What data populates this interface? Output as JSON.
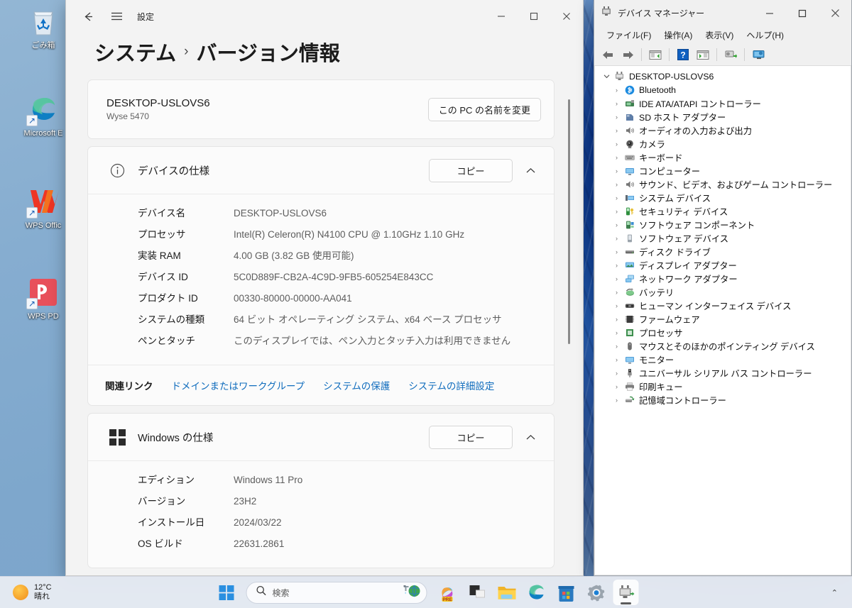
{
  "desktop": {
    "icons": [
      {
        "name": "recycle-bin",
        "label": "ごみ箱"
      },
      {
        "name": "microsoft-edge",
        "label": "Microsoft E"
      },
      {
        "name": "wps-office",
        "label": "WPS Offic"
      },
      {
        "name": "wps-pdf",
        "label": "WPS PD"
      }
    ]
  },
  "settings": {
    "title": "設定",
    "breadcrumb": {
      "parent": "システム",
      "separator": "›",
      "current": "バージョン情報"
    },
    "window_buttons": {
      "minimize": "—",
      "maximize": "☐",
      "close": "✕"
    },
    "pc_card": {
      "name": "DESKTOP-USLOVS6",
      "model": "Wyse 5470",
      "rename_button": "この PC の名前を変更"
    },
    "device_spec": {
      "title": "デバイスの仕様",
      "copy_button": "コピー",
      "rows": [
        {
          "key": "デバイス名",
          "value": "DESKTOP-USLOVS6"
        },
        {
          "key": "プロセッサ",
          "value": "Intel(R) Celeron(R) N4100 CPU @ 1.10GHz   1.10 GHz"
        },
        {
          "key": "実装 RAM",
          "value": "4.00 GB (3.82 GB 使用可能)"
        },
        {
          "key": "デバイス ID",
          "value": "5C0D889F-CB2A-4C9D-9FB5-605254E843CC"
        },
        {
          "key": "プロダクト ID",
          "value": "00330-80000-00000-AA041"
        },
        {
          "key": "システムの種類",
          "value": "64 ビット オペレーティング システム、x64 ベース プロセッサ"
        },
        {
          "key": "ペンとタッチ",
          "value": "このディスプレイでは、ペン入力とタッチ入力は利用できません"
        }
      ],
      "related_links_label": "関連リンク",
      "related_links": [
        "ドメインまたはワークグループ",
        "システムの保護",
        "システムの詳細設定"
      ]
    },
    "windows_spec": {
      "title": "Windows の仕様",
      "copy_button": "コピー",
      "rows": [
        {
          "key": "エディション",
          "value": "Windows 11 Pro"
        },
        {
          "key": "バージョン",
          "value": "23H2"
        },
        {
          "key": "インストール日",
          "value": "2024/03/22"
        },
        {
          "key": "OS ビルド",
          "value": "22631.2861"
        }
      ]
    }
  },
  "device_manager": {
    "title": "デバイス マネージャー",
    "window_buttons": {
      "minimize": "—",
      "maximize": "☐",
      "close": "✕"
    },
    "menus": [
      "ファイル(F)",
      "操作(A)",
      "表示(V)",
      "ヘルプ(H)"
    ],
    "toolbar_icons": [
      "back-arrow-icon",
      "forward-arrow-icon",
      "show-hide-console-tree-icon",
      "help-icon",
      "properties-icon",
      "update-driver-icon",
      "scan-for-hardware-changes-icon"
    ],
    "root": {
      "label": "DESKTOP-USLOVS6",
      "expanded": true
    },
    "nodes": [
      {
        "label": "Bluetooth",
        "icon": "bluetooth-icon"
      },
      {
        "label": "IDE ATA/ATAPI コントローラー",
        "icon": "ide-controller-icon"
      },
      {
        "label": "SD ホスト アダプター",
        "icon": "sd-host-adapter-icon"
      },
      {
        "label": "オーディオの入力および出力",
        "icon": "audio-icon"
      },
      {
        "label": "カメラ",
        "icon": "camera-icon"
      },
      {
        "label": "キーボード",
        "icon": "keyboard-icon"
      },
      {
        "label": "コンピューター",
        "icon": "computer-icon"
      },
      {
        "label": "サウンド、ビデオ、およびゲーム コントローラー",
        "icon": "sound-icon"
      },
      {
        "label": "システム デバイス",
        "icon": "system-device-icon"
      },
      {
        "label": "セキュリティ デバイス",
        "icon": "security-device-icon"
      },
      {
        "label": "ソフトウェア コンポーネント",
        "icon": "software-component-icon"
      },
      {
        "label": "ソフトウェア デバイス",
        "icon": "software-device-icon"
      },
      {
        "label": "ディスク ドライブ",
        "icon": "disk-drive-icon"
      },
      {
        "label": "ディスプレイ アダプター",
        "icon": "display-adapter-icon"
      },
      {
        "label": "ネットワーク アダプター",
        "icon": "network-adapter-icon"
      },
      {
        "label": "バッテリ",
        "icon": "battery-icon"
      },
      {
        "label": "ヒューマン インターフェイス デバイス",
        "icon": "hid-icon"
      },
      {
        "label": "ファームウェア",
        "icon": "firmware-icon"
      },
      {
        "label": "プロセッサ",
        "icon": "processor-icon"
      },
      {
        "label": "マウスとそのほかのポインティング デバイス",
        "icon": "mouse-icon"
      },
      {
        "label": "モニター",
        "icon": "monitor-icon"
      },
      {
        "label": "ユニバーサル シリアル バス コントローラー",
        "icon": "usb-controller-icon"
      },
      {
        "label": "印刷キュー",
        "icon": "print-queue-icon"
      },
      {
        "label": "記憶域コントローラー",
        "icon": "storage-controller-icon"
      }
    ]
  },
  "taskbar": {
    "weather": {
      "temperature": "12°C",
      "condition": "晴れ"
    },
    "search_placeholder": "検索",
    "apps": [
      {
        "name": "start",
        "label": "スタート"
      },
      {
        "name": "copilot",
        "label": "Copilot"
      },
      {
        "name": "widgets",
        "label": "ウィジェット"
      },
      {
        "name": "file-explorer",
        "label": "エクスプローラー"
      },
      {
        "name": "microsoft-edge",
        "label": "Microsoft Edge"
      },
      {
        "name": "microsoft-store",
        "label": "Microsoft Store"
      },
      {
        "name": "settings",
        "label": "設定"
      },
      {
        "name": "device-manager",
        "label": "デバイス マネージャー"
      }
    ],
    "tray_chevron": "⌃"
  },
  "colors": {
    "accent": "#0f6cbd",
    "window_bg": "#f3f3f3",
    "card_bg": "#fbfbfb",
    "taskbar_bg": "#e7ebf3"
  }
}
